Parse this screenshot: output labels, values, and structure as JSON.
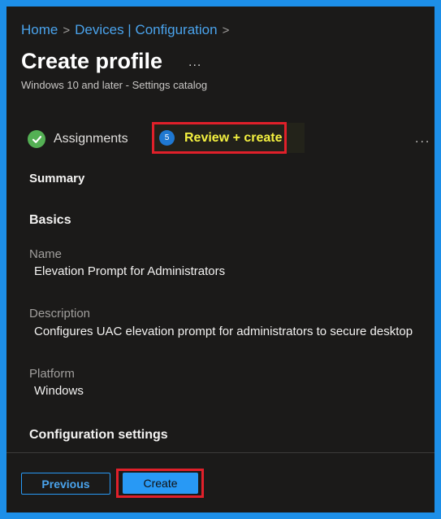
{
  "breadcrumb": {
    "home": "Home",
    "devices": "Devices | Configuration",
    "separator": ">"
  },
  "header": {
    "title": "Create profile",
    "more": "...",
    "subtitle": "Windows 10 and later - Settings catalog"
  },
  "wizard": {
    "assignments_label": "Assignments",
    "review_number": "5",
    "review_label": "Review + create",
    "more": "..."
  },
  "summary": {
    "heading": "Summary",
    "basics_heading": "Basics",
    "name_label": "Name",
    "name_value": "Elevation Prompt for Administrators",
    "description_label": "Description",
    "description_value": "Configures UAC elevation prompt for administrators to secure desktop",
    "platform_label": "Platform",
    "platform_value": "Windows",
    "config_heading": "Configuration settings"
  },
  "footer": {
    "previous_label": "Previous",
    "create_label": "Create"
  },
  "colors": {
    "accent": "#2899f5",
    "link": "#4aa3ec",
    "highlight_border": "#e0202a",
    "highlight_text": "#f4f140",
    "background": "#1b1a19",
    "success": "#54b054"
  }
}
